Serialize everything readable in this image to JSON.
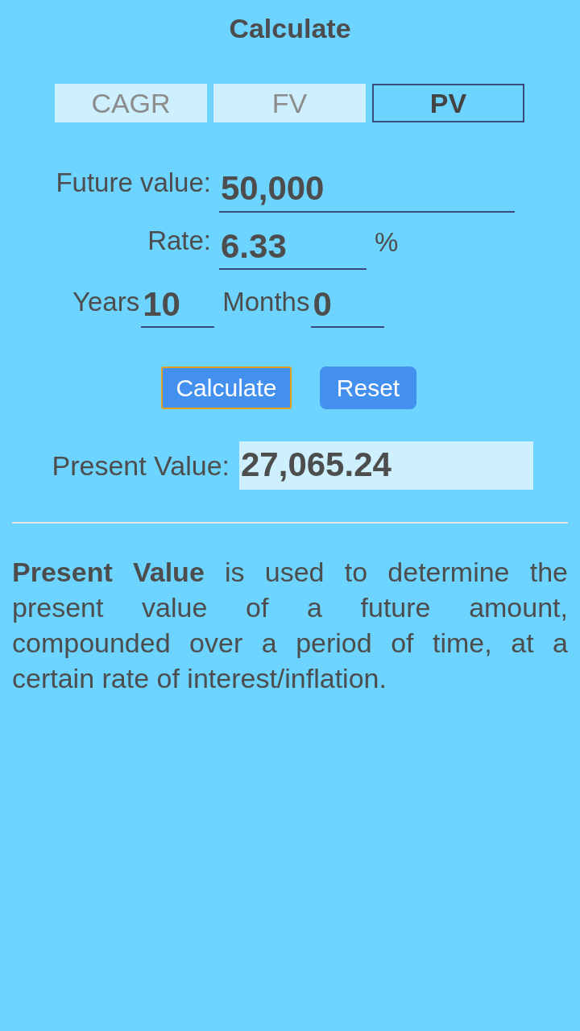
{
  "title": "Calculate",
  "tabs": [
    {
      "label": "CAGR",
      "selected": false
    },
    {
      "label": "FV",
      "selected": false
    },
    {
      "label": "PV",
      "selected": true
    }
  ],
  "fields": [
    {
      "label": "Future value:",
      "value": "50,000"
    },
    {
      "label": "Rate:",
      "value": "6.33",
      "unit": "%"
    }
  ],
  "period": [
    {
      "label": "Years",
      "value": "10"
    },
    {
      "label": "Months",
      "value": "0"
    }
  ],
  "buttons": [
    {
      "label": "Calculate",
      "focused": true
    },
    {
      "label": "Reset",
      "focused": false
    }
  ],
  "result": {
    "label": "Present Value:",
    "value": "27,065.24"
  },
  "description": "**Present Value** is used to determine the present value of a future amount, compounded over a period of time, at a certain rate of interest/inflation."
}
